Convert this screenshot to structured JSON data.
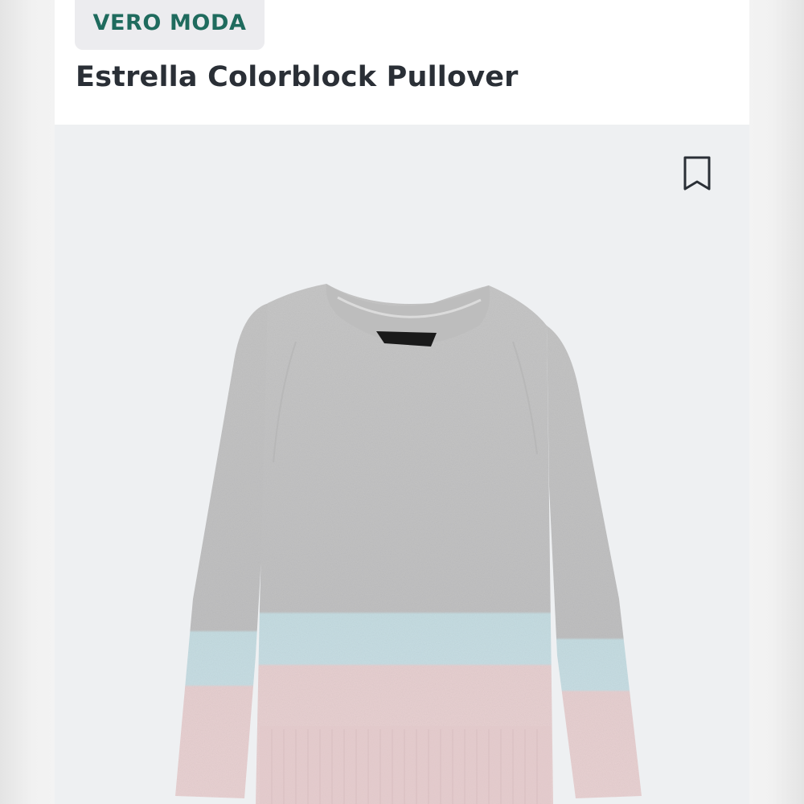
{
  "product": {
    "brand": "VERO MODA",
    "title": "Estrella Colorblock Pullover",
    "bookmark_icon": "bookmark-icon",
    "image": {
      "alt": "Estrella Colorblock Pullover sweater",
      "stripes": [
        "grey",
        "light-blue",
        "pink"
      ],
      "colors": {
        "grey": "#c3c3c3",
        "blue": "#c5dde2",
        "pink": "#e6cfd0"
      }
    }
  },
  "colors": {
    "brand_text": "#1f6b5e",
    "title_text": "#2a2f36",
    "badge_bg": "#ececef",
    "image_bg": "#eef0f2"
  }
}
